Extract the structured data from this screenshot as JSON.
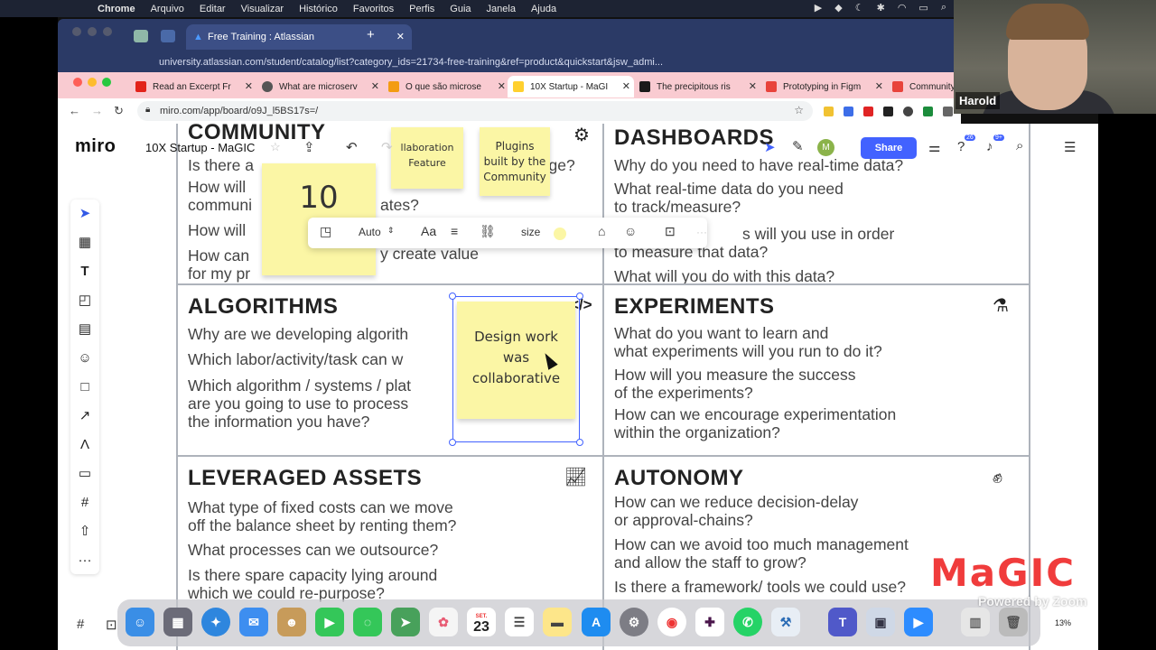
{
  "macos": {
    "apple": "",
    "menus": [
      "Chrome",
      "Arquivo",
      "Editar",
      "Visualizar",
      "Histórico",
      "Favoritos",
      "Perfis",
      "Guia",
      "Janela",
      "Ajuda"
    ]
  },
  "chrome_back": {
    "tab_title": "Free Training : Atlassian",
    "url": "university.atlassian.com/student/catalog/list?category_ids=21734-free-training&ref=product&quickstart&jsw_admi..."
  },
  "chrome_front": {
    "tabs": [
      {
        "title": "Read an Excerpt Fr",
        "color": "#e2231a"
      },
      {
        "title": "What are microserv",
        "color": "#555555"
      },
      {
        "title": "O que são microse",
        "color": "#f39c12"
      },
      {
        "title": "10X Startup - MaGI",
        "color": "#ffd02f"
      },
      {
        "title": "The precipitous ris",
        "color": "#1a1a1a"
      },
      {
        "title": "Prototyping in Figm",
        "color": "#e8433b"
      },
      {
        "title": "Community",
        "color": "#e8433b"
      }
    ],
    "url": "miro.com/app/board/o9J_l5BS17s=/"
  },
  "miro": {
    "logo": "miro",
    "board_name": "10X Startup - MaGIC",
    "share_label": "Share",
    "avatar_initial": "M",
    "notif_count_1": "26",
    "notif_count_2": "9+",
    "ctx": {
      "auto": "Auto",
      "font": "Aa",
      "size": "size",
      "more": "···"
    },
    "zoom": "13%"
  },
  "cells": {
    "community": {
      "title": "COMMUNITY",
      "q1": "Is there a",
      "q1b": "ve",
      "q1c": "rage?",
      "q2": "How will",
      "q2b": "communi",
      "q2c": "ates?",
      "q3": "How will",
      "q4": "How can",
      "q4b": "y create value",
      "q5": "for my pr"
    },
    "dashboards": {
      "title": "DASHBOARDS",
      "q1": "Why do you need to have real-time data?",
      "q2": "What real-time data do you need\nto track/measure?",
      "q3": "s will you use in order",
      "q3b": "to measure that data?",
      "q4": "What will you do with this data?"
    },
    "algorithms": {
      "title": "ALGORITHMS",
      "q1": "Why are we developing algorith",
      "q2": "Which labor/activity/task  can w",
      "q3": "Which algorithm / systems / plat\nare you going to use to process\nthe information you have?"
    },
    "experiments": {
      "title": "EXPERIMENTS",
      "q1": "What do you want to learn and\nwhat experiments will you run to do it?",
      "q2": "How will you measure the success\nof the experiments?",
      "q3": "How can we encourage experimentation\nwithin the organization?"
    },
    "leveraged": {
      "title": "LEVERAGED ASSETS",
      "q1": "What type of fixed costs can we move\noff the balance sheet by renting them?",
      "q2": "What processes can we outsource?",
      "q3": "Is there spare capacity lying around\nwhich we could re-purpose?"
    },
    "autonomy": {
      "title": "AUTONOMY",
      "q1": "How can we reduce decision-delay\nor approval-chains?",
      "q2": "How can we avoid too much management\nand allow the staff to grow?",
      "q3": "Is there a framework/ tools we could  use?"
    }
  },
  "stickies": {
    "ten": "10",
    "collab": "llaboration\nFeature",
    "plugins": "Plugins\nbuilt by the\nCommunity",
    "design": "Design work\nwas\ncollaborative"
  },
  "overlay": {
    "webcam_name": "Harold",
    "magic": "MaGIC",
    "powered": "Powered by Zoom"
  },
  "dock": {
    "calendar_month": "SET.",
    "calendar_day": "23"
  }
}
